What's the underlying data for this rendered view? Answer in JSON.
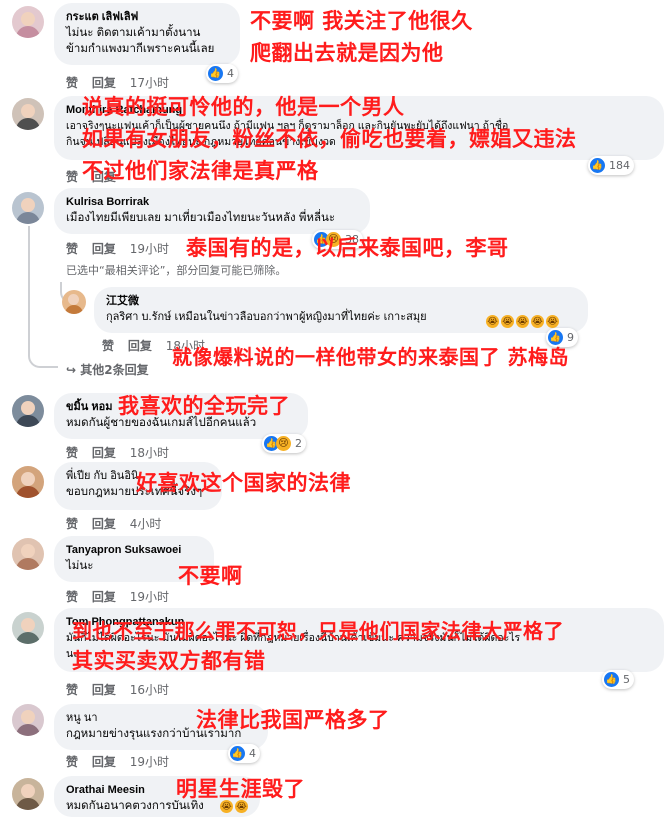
{
  "comments": [
    {
      "name": "กระแต เลิฟเลิฟ",
      "lines": [
        "ไม่นะ ติดตามเค้ามาตั้งนาน",
        "ข้ามกำแพงมากีเพราะคนนี้เลย"
      ],
      "actions": [
        "赞",
        "回复",
        "17小时"
      ],
      "reactions": "4"
    },
    {
      "name": "Monthira Ratchamung",
      "lines": [
        "เอาจริงๆนะแฟนเค้าก็เป็นผู้ชายคนนึง ถ้ามีแฟน ฯลฯ ก็ดูรามาล็อก และกินยันพะยับได้ถึงแฟนา ถ้าชื่อ",
        "กินจนเปลี่ยนแปลงเมืองไทยนะ กฎหมายไทยค่อนข้างเข้มงวด"
      ],
      "actions": [
        "赞",
        "回复"
      ],
      "reactions": "184"
    },
    {
      "name": "Kulrisa Borrirak",
      "lines": [
        "เมืองไทยมีเพียบเลย มาเที่ยวเมืองไทยนะวันหลัง พี่หลี่นะ"
      ],
      "actions": [
        "赞",
        "回复",
        "19小时"
      ],
      "reactions": "38"
    },
    {
      "name": "江艾微",
      "lines": [
        "กุลริศา บ.รักษ์ เหมือนในข่าวลือบอกว่าพาผู้หญิงมาที่ไทยค่ะ เกาะสมุย"
      ],
      "actions": [
        "赞",
        "回复",
        "18小时"
      ],
      "reactions": "9"
    },
    {
      "name": "ขมิ้น หอม",
      "lines": [
        "หมดกันผู้ชายของฉันเกมส์ไปอีกคนแล้ว"
      ],
      "actions": [
        "赞",
        "回复",
        "18小时"
      ],
      "reactions": "2"
    },
    {
      "name": "พี่เปีย กับ อินอินิ",
      "lines": [
        "ขอบกฎหมายประเทศนี้จริงๆ"
      ],
      "actions": [
        "赞",
        "回复",
        "4小时"
      ],
      "reactions": ""
    },
    {
      "name": "Tanyapron Suksawoei",
      "lines": [
        "ไม่นะ"
      ],
      "actions": [
        "赞",
        "回复",
        "19小时"
      ],
      "reactions": ""
    },
    {
      "name": "Tom Phongpattanakun",
      "lines": [
        "มันก็ไม่ได้ผิดอะไรนะ มันไม่ผิดอะไรนะ ผิดที่กฎหมายเรื่องนี้บ้านเค้าเข้มนะ ความจริงมันก็ไม่ได้ผิดอะไร",
        "นะ"
      ],
      "actions": [
        "赞",
        "回复",
        "16小时"
      ],
      "reactions": "5"
    },
    {
      "name": "หนู นา",
      "lines": [
        "กฎหมายข่างรุนแรงกว่าบ้านเรามาก"
      ],
      "actions": [
        "赞",
        "回复",
        "19小时"
      ],
      "reactions": "4"
    },
    {
      "name": "Orathai Meesin",
      "lines": [
        "หมดกันอนาคตวงการบันเทิง"
      ],
      "actions": [],
      "reactions": ""
    }
  ],
  "reply_note": "已选中“最相关评论”，部分回复可能已筛除。",
  "more_replies": "其他2条回复",
  "annotations": [
    "不要啊 我关注了他很久",
    "爬翻出去就是因为他",
    "说真的挺可怜他的，他是一个男人",
    "如果有女朋友，粉丝不依，偷吃也要着，嫖娼又违法",
    "不过他们家法律是真严格",
    "泰国有的是，以后来泰国吧，李哥",
    "就像爆料说的一样他带女的来泰国了 苏梅岛",
    "我喜欢的全玩完了",
    "好喜欢这个国家的法律",
    "不要啊",
    "到也不至于那么罪不可恕，只是他们国家法律大严格了",
    "其实买卖双方都有错",
    "法律比我国严格多了",
    "明星生涯毁了"
  ],
  "colors": {
    "annotation": "#ff1c1c",
    "bubble": "#f0f2f5",
    "like": "#1877f2",
    "meta": "#65676b"
  }
}
